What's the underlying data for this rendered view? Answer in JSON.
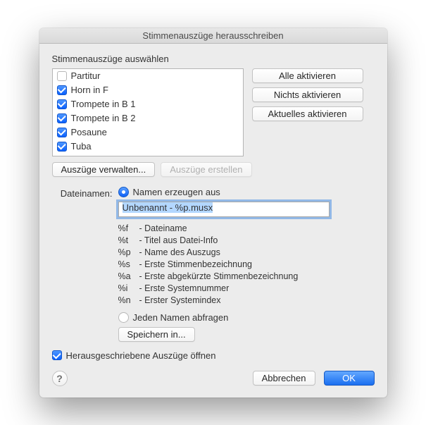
{
  "title": "Stimmenauszüge herausschreiben",
  "section_select_label": "Stimmenauszüge auswählen",
  "parts": [
    {
      "label": "Partitur",
      "checked": false
    },
    {
      "label": "Horn in F",
      "checked": true
    },
    {
      "label": "Trompete in B 1",
      "checked": true
    },
    {
      "label": "Trompete in B 2",
      "checked": true
    },
    {
      "label": "Posaune",
      "checked": true
    },
    {
      "label": "Tuba",
      "checked": true
    }
  ],
  "side_buttons": {
    "all": "Alle aktivieren",
    "none": "Nichts aktivieren",
    "current": "Aktuelles aktivieren"
  },
  "manage_buttons": {
    "manage": "Auszüge verwalten...",
    "create": "Auszüge erstellen"
  },
  "filenames": {
    "label": "Dateinamen:",
    "radio_generate": "Namen erzeugen aus",
    "input_value": "Unbenannt - %p.musx",
    "legend": [
      {
        "key": "%f",
        "desc": "Dateiname"
      },
      {
        "key": "%t",
        "desc": "Titel aus Datei-Info"
      },
      {
        "key": "%p",
        "desc": "Name des Auszugs"
      },
      {
        "key": "%s",
        "desc": "Erste Stimmenbezeichnung"
      },
      {
        "key": "%a",
        "desc": "Erste abgekürzte Stimmenbezeichnung"
      },
      {
        "key": "%i",
        "desc": "Erste Systemnummer"
      },
      {
        "key": "%n",
        "desc": "Erster Systemindex"
      }
    ],
    "radio_prompt": "Jeden Namen abfragen",
    "save_into": "Speichern in..."
  },
  "open_extracted": "Herausgeschriebene Auszüge öffnen",
  "footer": {
    "help": "?",
    "cancel": "Abbrechen",
    "ok": "OK"
  }
}
